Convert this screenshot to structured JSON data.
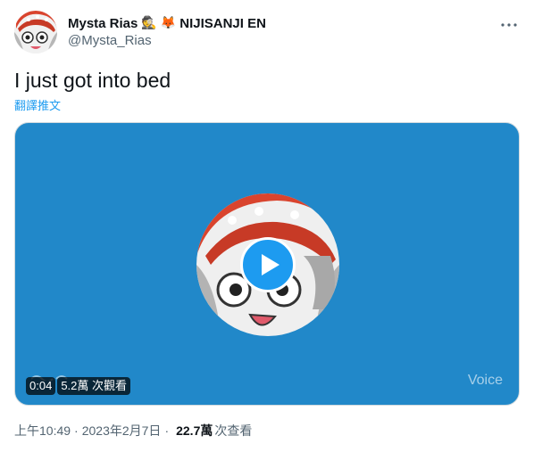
{
  "author": {
    "display_name": "Mysta Rias",
    "emoji_detective": "🕵",
    "emoji_fox": "🦊",
    "affiliation": "NIJISANJI EN",
    "handle": "@Mysta_Rias"
  },
  "tweet": {
    "text": "I just got into bed",
    "translate_label": "翻譯推文"
  },
  "media": {
    "type_label": "Voice",
    "duration": "0:04",
    "views": "5.2萬 次觀看",
    "background_color": "#2188c9",
    "play_color": "#1d9bf0"
  },
  "meta": {
    "time": "上午10:49",
    "separator": "·",
    "date": "2023年2月7日",
    "separator2": "·",
    "view_count": "22.7萬",
    "view_label": "次查看"
  },
  "icons": {
    "more": "more-horizontal-icon",
    "play": "play-icon"
  }
}
